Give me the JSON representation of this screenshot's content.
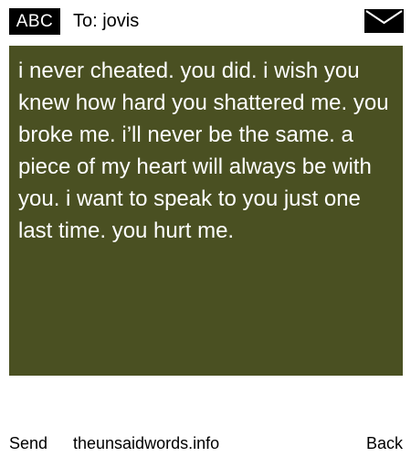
{
  "header": {
    "mode_badge": "ABC",
    "recipient": "To: jovis",
    "icon": "envelope-icon"
  },
  "message": {
    "text": "i never cheated. you did. i wish you knew how hard you shattered me. you broke me. i’ll never be the same. a piece of my heart will always be with you. i want to speak to you just one last time. you hurt me.",
    "background_color": "#4a5022",
    "text_color": "#ffffff"
  },
  "footer": {
    "send_label": "Send",
    "site_label": "theunsaidwords.info",
    "back_label": "Back"
  }
}
